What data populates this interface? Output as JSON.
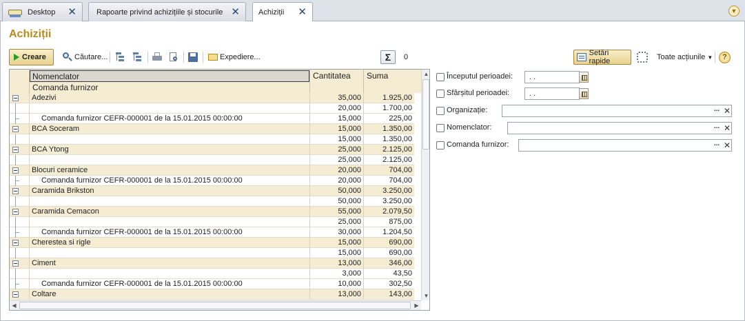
{
  "tabs": [
    {
      "label": "Desktop"
    },
    {
      "label": "Rapoarte privind achizițiile și stocurile"
    },
    {
      "label": "Achiziții"
    }
  ],
  "page": {
    "title": "Achiziții"
  },
  "toolbar": {
    "create_label": "Creare",
    "search_label": "Căutare...",
    "send_label": "Expediere...",
    "sum_value": "0",
    "quick_settings_label": "Setări rapide",
    "all_actions_label": "Toate acțiunile",
    "help_label": "?"
  },
  "table": {
    "headers": {
      "nomenclator": "Nomenclator",
      "comanda": "Comanda furnizor",
      "cantitate": "Cantitatea",
      "suma": "Suma"
    },
    "rows": [
      {
        "kind": "group",
        "name": "Adezivi",
        "qty": "35,000",
        "sum": "1.925,00"
      },
      {
        "kind": "detail",
        "name": "",
        "qty": "20,000",
        "sum": "1.700,00"
      },
      {
        "kind": "sub",
        "name": "Comanda furnizor CEFR-000001 de la 15.01.2015 00:00:00",
        "qty": "15,000",
        "sum": "225,00"
      },
      {
        "kind": "group",
        "name": "BCA Soceram",
        "qty": "15,000",
        "sum": "1.350,00"
      },
      {
        "kind": "detail",
        "name": "",
        "qty": "15,000",
        "sum": "1.350,00"
      },
      {
        "kind": "group",
        "name": "BCA Ytong",
        "qty": "25,000",
        "sum": "2.125,00"
      },
      {
        "kind": "detail",
        "name": "",
        "qty": "25,000",
        "sum": "2.125,00"
      },
      {
        "kind": "group",
        "name": "Blocuri ceramice",
        "qty": "20,000",
        "sum": "704,00"
      },
      {
        "kind": "sub",
        "name": "Comanda furnizor CEFR-000001 de la 15.01.2015 00:00:00",
        "qty": "20,000",
        "sum": "704,00"
      },
      {
        "kind": "group",
        "name": "Caramida Brikston",
        "qty": "50,000",
        "sum": "3.250,00"
      },
      {
        "kind": "detail",
        "name": "",
        "qty": "50,000",
        "sum": "3.250,00"
      },
      {
        "kind": "group",
        "name": "Caramida Cemacon",
        "qty": "55,000",
        "sum": "2.079,50"
      },
      {
        "kind": "detail",
        "name": "",
        "qty": "25,000",
        "sum": "875,00"
      },
      {
        "kind": "sub",
        "name": "Comanda furnizor CEFR-000001 de la 15.01.2015 00:00:00",
        "qty": "30,000",
        "sum": "1.204,50"
      },
      {
        "kind": "group",
        "name": "Cherestea si rigle",
        "qty": "15,000",
        "sum": "690,00"
      },
      {
        "kind": "detail",
        "name": "",
        "qty": "15,000",
        "sum": "690,00"
      },
      {
        "kind": "group",
        "name": "Ciment",
        "qty": "13,000",
        "sum": "346,00"
      },
      {
        "kind": "detail",
        "name": "",
        "qty": "3,000",
        "sum": "43,50"
      },
      {
        "kind": "sub",
        "name": "Comanda furnizor CEFR-000001 de la 15.01.2015 00:00:00",
        "qty": "10,000",
        "sum": "302,50"
      },
      {
        "kind": "group",
        "name": "Coltare",
        "qty": "13,000",
        "sum": "143,00"
      }
    ]
  },
  "filters": {
    "start_label": "Începutul perioadei:",
    "start_value": ". .",
    "end_label": "Sfârșitul perioadei:",
    "end_value": ". .",
    "org_label": "Organizație:",
    "nom_label": "Nomenclator:",
    "cmd_label": "Comanda furnizor:"
  }
}
